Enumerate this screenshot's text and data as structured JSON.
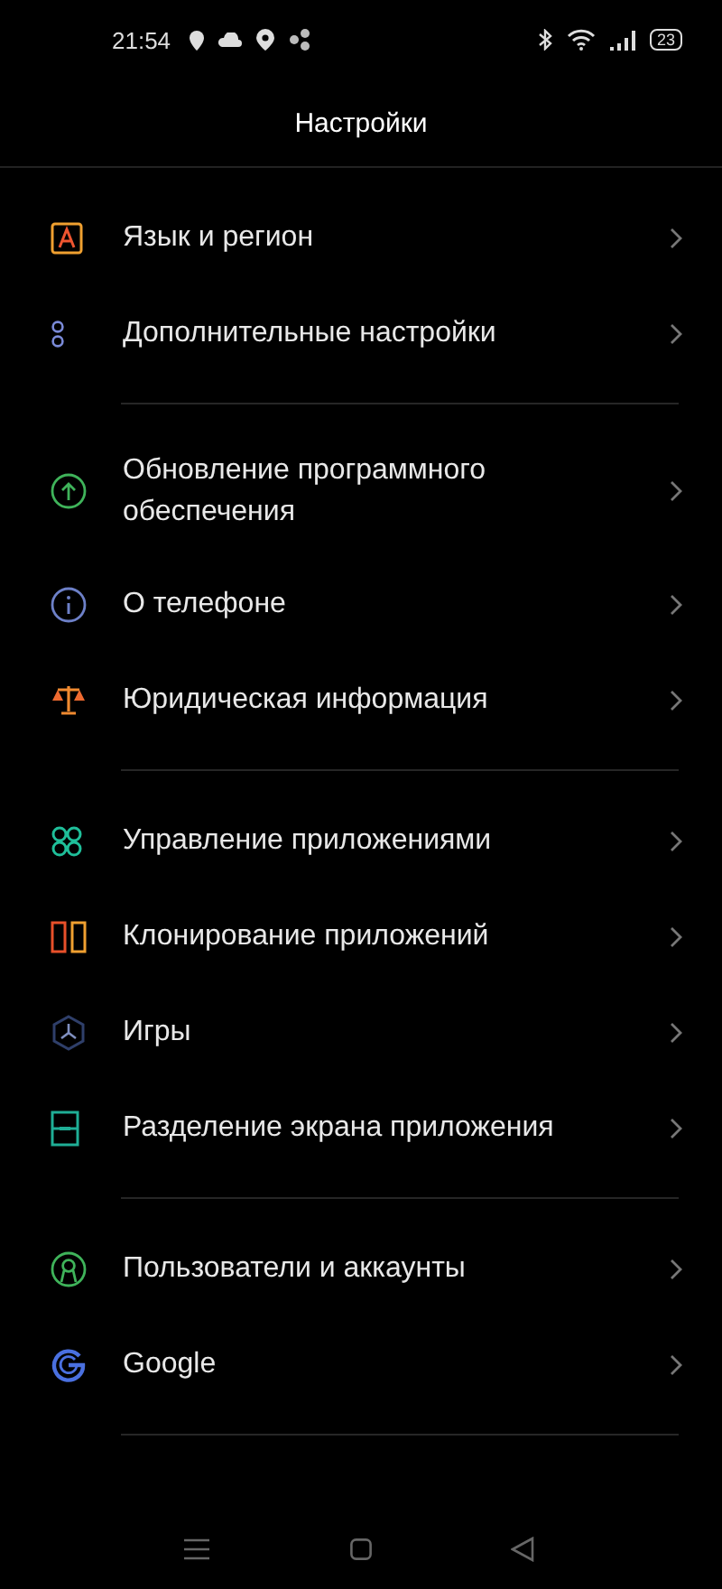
{
  "status_bar": {
    "time": "21:54",
    "battery": "23"
  },
  "title": "Настройки",
  "groups": [
    {
      "items": [
        {
          "kind": "language",
          "label": "Язык и регион"
        },
        {
          "kind": "more",
          "label": "Дополнительные настройки"
        }
      ]
    },
    {
      "items": [
        {
          "kind": "update",
          "label": "Обновление программного обеспечения"
        },
        {
          "kind": "info",
          "label": "О телефоне"
        },
        {
          "kind": "legal",
          "label": "Юридическая информация"
        }
      ]
    },
    {
      "items": [
        {
          "kind": "apps",
          "label": "Управление приложениями"
        },
        {
          "kind": "clone",
          "label": "Клонирование приложений"
        },
        {
          "kind": "games",
          "label": "Игры"
        },
        {
          "kind": "split",
          "label": "Разделение экрана приложения"
        }
      ]
    },
    {
      "items": [
        {
          "kind": "users",
          "label": "Пользователи и аккаунты"
        },
        {
          "kind": "google",
          "label": "Google"
        }
      ]
    }
  ]
}
